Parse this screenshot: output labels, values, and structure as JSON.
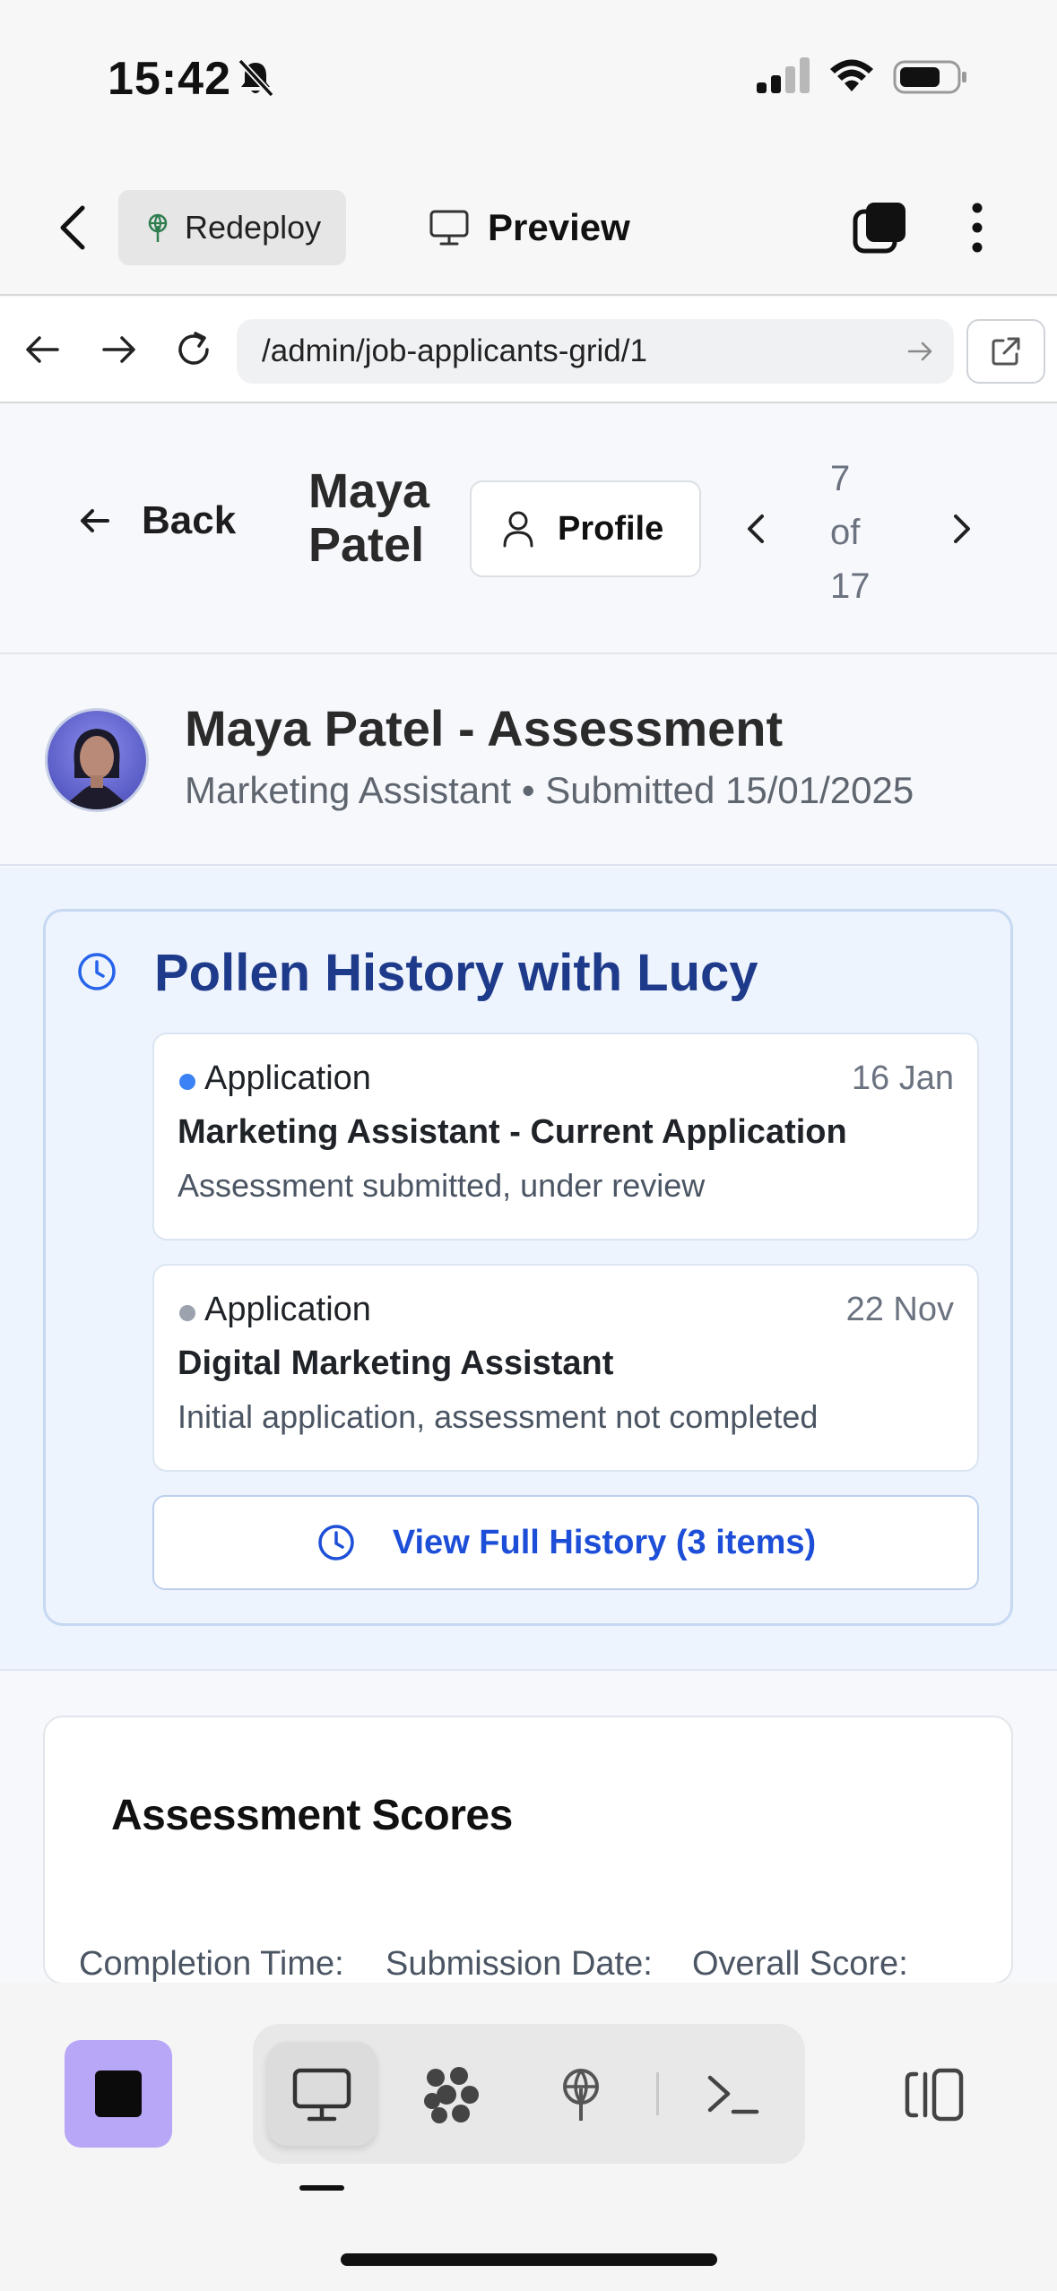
{
  "status_bar": {
    "time": "15:42"
  },
  "app_toolbar": {
    "redeploy_label": "Redeploy",
    "preview_label": "Preview"
  },
  "url_bar": {
    "url": "/admin/job-applicants-grid/1"
  },
  "page_header": {
    "back_label": "Back",
    "applicant_name": "Maya Patel",
    "profile_label": "Profile",
    "pager": "7 of 17"
  },
  "applicant": {
    "title": "Maya Patel - Assessment",
    "subtitle": "Marketing Assistant • Submitted 15/01/2025"
  },
  "history": {
    "title": "Pollen History with Lucy",
    "items": [
      {
        "type": "Application",
        "date": "16 Jan",
        "title": "Marketing Assistant - Current Application",
        "description": "Assessment submitted, under review",
        "dot_color": "#3b82f6"
      },
      {
        "type": "Application",
        "date": "22 Nov",
        "title": "Digital Marketing Assistant",
        "description": "Initial application, assessment not completed",
        "dot_color": "#9ca3af"
      }
    ],
    "view_full_label": "View Full History (3 items)"
  },
  "scores": {
    "title": "Assessment Scores",
    "labels": [
      "Completion Time:",
      "Submission Date:",
      "Overall Score:"
    ]
  },
  "colors": {
    "accent": "#1e3a8a",
    "link": "#1d4ed8",
    "stop_button": "#b8a6f7"
  }
}
